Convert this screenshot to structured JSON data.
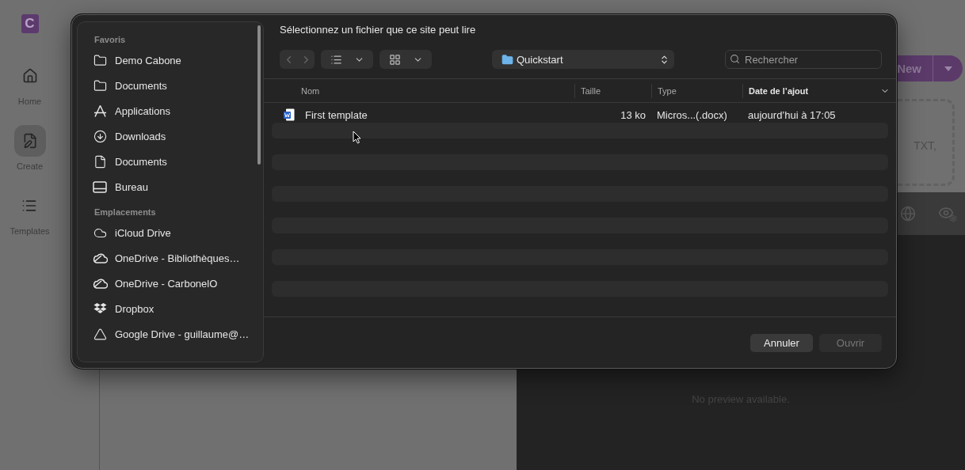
{
  "app": {
    "logo": "C",
    "nav": [
      {
        "label": "Home",
        "selected": false
      },
      {
        "label": "Create",
        "selected": true
      },
      {
        "label": "Templates",
        "selected": false
      }
    ],
    "new_button": "New",
    "dropzone_text": "TXT,",
    "preview_text": "No preview available."
  },
  "dialog": {
    "title": "Sélectionnez un fichier que ce site peut lire",
    "location": "Quickstart",
    "search": {
      "placeholder": "Rechercher"
    },
    "sidebar": [
      {
        "heading": "Favoris",
        "items": [
          {
            "label": "Demo Cabone",
            "kind": "folder"
          },
          {
            "label": "Documents",
            "kind": "folder"
          },
          {
            "label": "Applications",
            "kind": "apps"
          },
          {
            "label": "Downloads",
            "kind": "download"
          },
          {
            "label": "Documents",
            "kind": "document"
          },
          {
            "label": "Bureau",
            "kind": "desktop"
          }
        ]
      },
      {
        "heading": "Emplacements",
        "items": [
          {
            "label": "iCloud Drive",
            "kind": "cloud"
          },
          {
            "label": "OneDrive - Bibliothèques…",
            "kind": "onedrive"
          },
          {
            "label": "OneDrive - CarbonelO",
            "kind": "onedrive"
          },
          {
            "label": "Dropbox",
            "kind": "dropbox"
          },
          {
            "label": "Google Drive - guillaume@…",
            "kind": "drive"
          }
        ]
      }
    ],
    "columns": [
      {
        "label": "Nom",
        "sorted": false
      },
      {
        "label": "Taille",
        "sorted": false
      },
      {
        "label": "Type",
        "sorted": false
      },
      {
        "label": "Date de l’ajout",
        "sorted": true
      }
    ],
    "files": [
      {
        "name": "First template",
        "size": "13 ko",
        "type": "Micros...(.docx)",
        "date": "aujourd’hui à 17:05",
        "selected": false
      }
    ],
    "buttons": [
      {
        "label": "Annuler",
        "disabled": false
      },
      {
        "label": "Ouvrir",
        "disabled": true
      }
    ]
  }
}
